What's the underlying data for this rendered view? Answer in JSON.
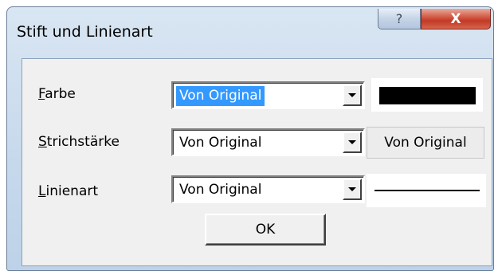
{
  "window": {
    "title": "Stift und Linienart",
    "help_glyph": "?",
    "close_glyph": "X"
  },
  "rows": [
    {
      "label": "Farbe",
      "mnemonic": "F",
      "rest": "arbe",
      "value": "Von Original",
      "selected": true
    },
    {
      "label": "Strichstärke",
      "mnemonic": "S",
      "rest": "trichstärke",
      "value": "Von Original",
      "selected": false
    },
    {
      "label": "Linienart",
      "mnemonic": "L",
      "rest": "inienart",
      "value": "Von Original",
      "selected": false
    }
  ],
  "previews": {
    "color": "#000000",
    "width_text": "Von Original"
  },
  "ok_label": "OK",
  "icons": {
    "help": "help-icon",
    "close": "close-icon",
    "dropdown": "chevron-down-icon"
  }
}
